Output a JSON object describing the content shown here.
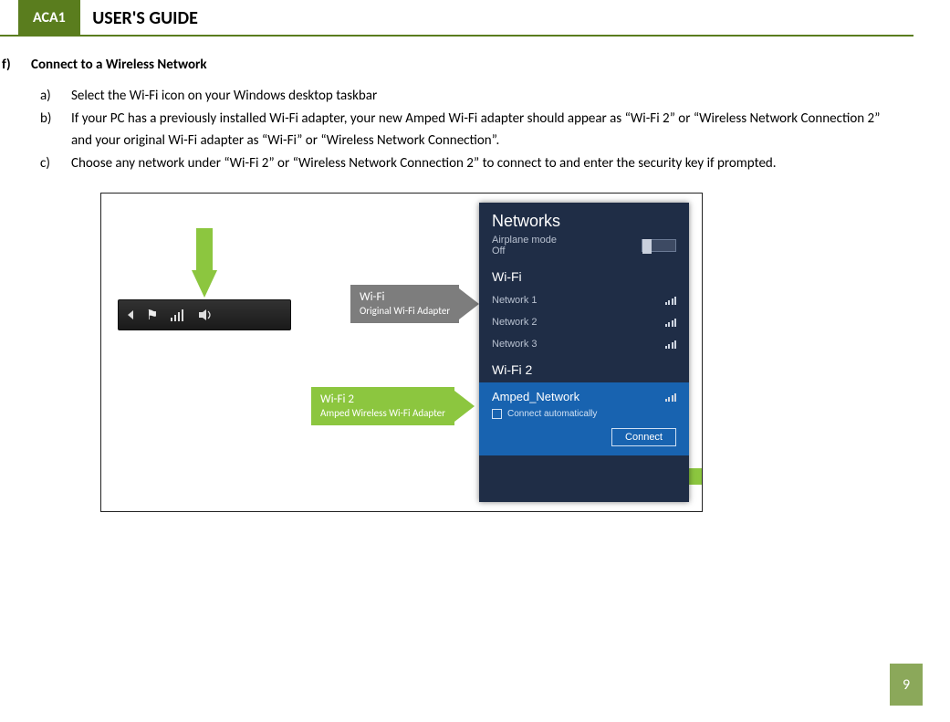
{
  "header": {
    "badge": "ACA1",
    "title": "USER'S GUIDE"
  },
  "section": {
    "letter": "f)",
    "title": "Connect to a Wireless  Network"
  },
  "steps": [
    {
      "letter": "a)",
      "text": "Select the Wi-Fi icon on your Windows desktop taskbar"
    },
    {
      "letter": "b)",
      "text": "If your PC has a previously installed Wi-Fi adapter, your new Amped Wi-Fi adapter should appear as “Wi-Fi 2” or “Wireless Network Connection 2” and your original Wi-Fi adapter as “Wi-Fi” or “Wireless Network Connection”."
    },
    {
      "letter": "c)",
      "text": "Choose any network under “Wi-Fi 2” or “Wireless Network Connection 2” to connect to and enter the security key if prompted."
    }
  ],
  "figure": {
    "networks_panel": {
      "title": "Networks",
      "airplane_label": "Airplane mode",
      "airplane_state": "Off",
      "section1": "Wi-Fi",
      "items1": [
        "Network 1",
        "Network 2",
        "Network 3"
      ],
      "section2": "Wi-Fi 2",
      "selected_network": "Amped_Network",
      "auto_label": "Connect automatically",
      "connect_label": "Connect"
    },
    "callouts": {
      "wifi1_title": "Wi-Fi",
      "wifi1_sub": "Original Wi-Fi Adapter",
      "wifi2_title": "Wi-Fi 2",
      "wifi2_sub": "Amped Wireless Wi-Fi Adapter"
    }
  },
  "page_number": "9"
}
